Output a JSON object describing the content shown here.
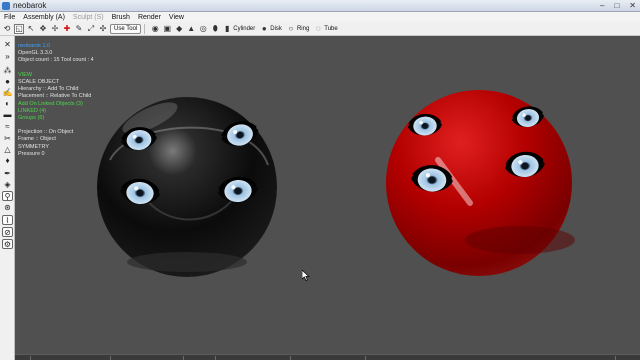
{
  "window": {
    "title": "neobarok",
    "controls": [
      "–",
      "□",
      "✕"
    ]
  },
  "menubar": {
    "items": [
      {
        "label": "File",
        "enabled": true
      },
      {
        "label": "Assembly (A)",
        "enabled": true
      },
      {
        "label": "Sculpt (S)",
        "enabled": false
      },
      {
        "label": "Brush",
        "enabled": true
      },
      {
        "label": "Render",
        "enabled": true
      },
      {
        "label": "View",
        "enabled": true
      }
    ]
  },
  "toolbar": {
    "use_tool_label": "Use Tool",
    "primitives": [
      "Cylinder",
      "Disk",
      "Ring",
      "Tube"
    ]
  },
  "info": {
    "app": "neobarok 1.0",
    "opengl": "OpenGL 3.3.0",
    "counts": "Object count : 15   Tool count : 4",
    "view": "VIEW",
    "scale": "SCALE OBJECT",
    "hierarchy": "Hierarchy :: Add To Child",
    "placement": "Placement :: Relative To Child",
    "add_linked": "Add On Linked Objects (3)",
    "linked": "LINKED (4)",
    "groups": "Groups (6)",
    "projection": "Projection :: On Object",
    "frame": "Frame :: Object",
    "symmetry": "SYMMETRY",
    "pressure": "Pressure 0"
  },
  "colors": {
    "viewport_bg": "#505050",
    "info_blue": "#39a3ff",
    "info_green": "#4ed64e",
    "sphere_left": "#0c0c0c",
    "sphere_right": "#b20000",
    "eye_iris": "#a9c6de"
  },
  "scene": {
    "objects": [
      {
        "name": "black-sphere",
        "color": "#0c0c0c"
      },
      {
        "name": "red-sphere",
        "color": "#b20000"
      }
    ]
  }
}
